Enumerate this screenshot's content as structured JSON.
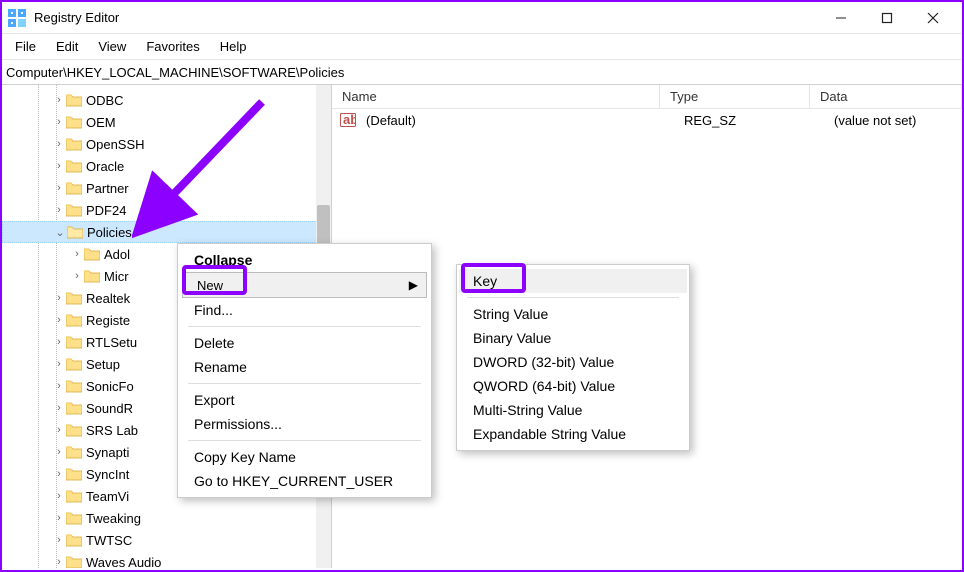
{
  "window": {
    "title": "Registry Editor"
  },
  "menus": {
    "file": "File",
    "edit": "Edit",
    "view": "View",
    "favorites": "Favorites",
    "help": "Help"
  },
  "address": "Computer\\HKEY_LOCAL_MACHINE\\SOFTWARE\\Policies",
  "tree": [
    {
      "label": "ODBC",
      "depth": 0,
      "expanded": false,
      "hasChildren": true
    },
    {
      "label": "OEM",
      "depth": 0,
      "expanded": false,
      "hasChildren": true
    },
    {
      "label": "OpenSSH",
      "depth": 0,
      "expanded": false,
      "hasChildren": true
    },
    {
      "label": "Oracle",
      "depth": 0,
      "expanded": false,
      "hasChildren": true
    },
    {
      "label": "Partner",
      "depth": 0,
      "expanded": false,
      "hasChildren": true
    },
    {
      "label": "PDF24",
      "depth": 0,
      "expanded": false,
      "hasChildren": true
    },
    {
      "label": "Policies",
      "depth": 0,
      "expanded": true,
      "hasChildren": true,
      "selected": true
    },
    {
      "label": "Adol",
      "depth": 1,
      "expanded": false,
      "hasChildren": true
    },
    {
      "label": "Micr",
      "depth": 1,
      "expanded": false,
      "hasChildren": true
    },
    {
      "label": "Realtek",
      "depth": 0,
      "expanded": false,
      "hasChildren": true
    },
    {
      "label": "Registe",
      "depth": 0,
      "expanded": false,
      "hasChildren": true
    },
    {
      "label": "RTLSetu",
      "depth": 0,
      "expanded": false,
      "hasChildren": true
    },
    {
      "label": "Setup",
      "depth": 0,
      "expanded": false,
      "hasChildren": true
    },
    {
      "label": "SonicFo",
      "depth": 0,
      "expanded": false,
      "hasChildren": true
    },
    {
      "label": "SoundR",
      "depth": 0,
      "expanded": false,
      "hasChildren": true
    },
    {
      "label": "SRS Lab",
      "depth": 0,
      "expanded": false,
      "hasChildren": true
    },
    {
      "label": "Synapti",
      "depth": 0,
      "expanded": false,
      "hasChildren": true
    },
    {
      "label": "SyncInt",
      "depth": 0,
      "expanded": false,
      "hasChildren": true
    },
    {
      "label": "TeamVi",
      "depth": 0,
      "expanded": false,
      "hasChildren": true
    },
    {
      "label": "Tweaking",
      "depth": 0,
      "expanded": false,
      "hasChildren": true
    },
    {
      "label": "TWTSC",
      "depth": 0,
      "expanded": false,
      "hasChildren": true
    },
    {
      "label": "Waves Audio",
      "depth": 0,
      "expanded": false,
      "hasChildren": true
    }
  ],
  "list": {
    "headers": {
      "name": "Name",
      "type": "Type",
      "data": "Data"
    },
    "rows": [
      {
        "name": "(Default)",
        "type": "REG_SZ",
        "data": "(value not set)"
      }
    ]
  },
  "context_menu_1": {
    "collapse": "Collapse",
    "new": "New",
    "find": "Find...",
    "delete": "Delete",
    "rename": "Rename",
    "export": "Export",
    "permissions": "Permissions...",
    "copykey": "Copy Key Name",
    "goto": "Go to HKEY_CURRENT_USER"
  },
  "context_menu_2": {
    "key": "Key",
    "string": "String Value",
    "binary": "Binary Value",
    "dword": "DWORD (32-bit) Value",
    "qword": "QWORD (64-bit) Value",
    "multistring": "Multi-String Value",
    "expandable": "Expandable String Value"
  }
}
